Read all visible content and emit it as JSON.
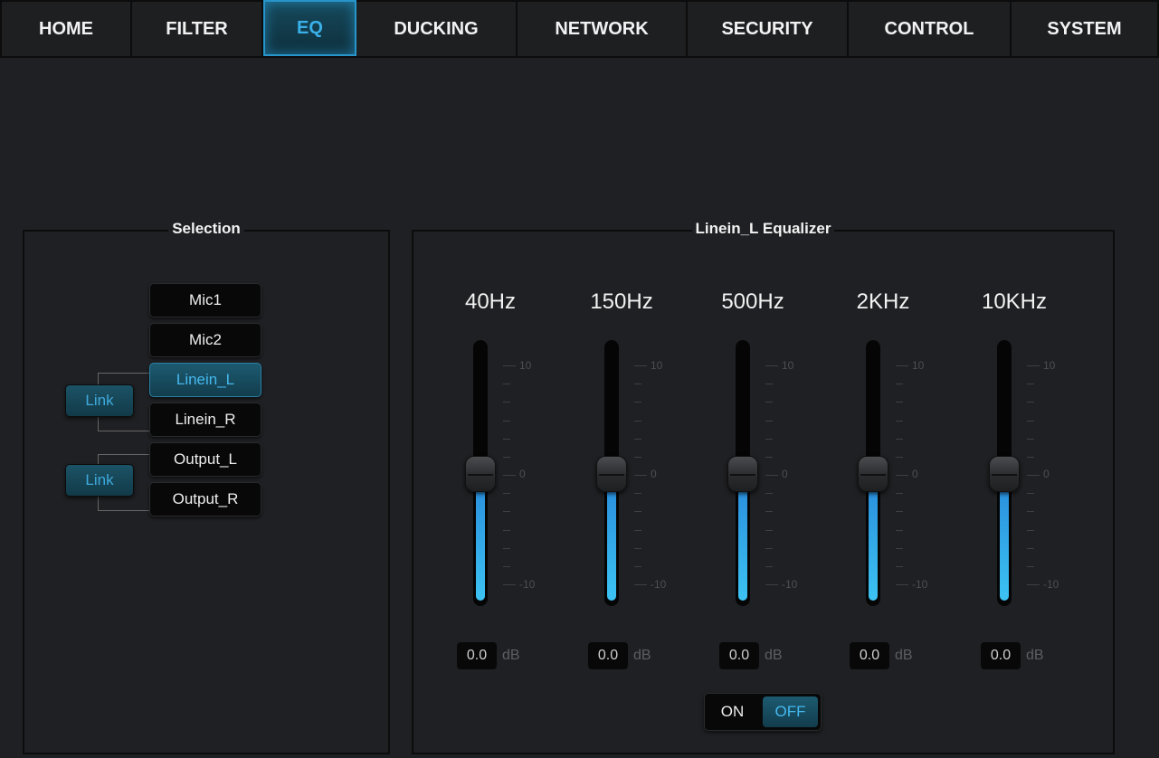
{
  "nav": {
    "tabs": [
      {
        "label": "HOME"
      },
      {
        "label": "FILTER"
      },
      {
        "label": "EQ"
      },
      {
        "label": "DUCKING"
      },
      {
        "label": "NETWORK"
      },
      {
        "label": "SECURITY"
      },
      {
        "label": "CONTROL"
      },
      {
        "label": "SYSTEM"
      }
    ],
    "active": "EQ"
  },
  "selection": {
    "title": "Selection",
    "channels": [
      {
        "label": "Mic1"
      },
      {
        "label": "Mic2"
      },
      {
        "label": "Linein_L"
      },
      {
        "label": "Linein_R"
      },
      {
        "label": "Output_L"
      },
      {
        "label": "Output_R"
      }
    ],
    "active_channel": "Linein_L",
    "link_labels": [
      "Link",
      "Link"
    ]
  },
  "equalizer": {
    "title": "Linein_L Equalizer",
    "scale": {
      "max": "10",
      "mid": "0",
      "min": "-10"
    },
    "unit": "dB",
    "bands": [
      {
        "label": "40Hz",
        "value": "0.0"
      },
      {
        "label": "150Hz",
        "value": "0.0"
      },
      {
        "label": "500Hz",
        "value": "0.0"
      },
      {
        "label": "2KHz",
        "value": "0.0"
      },
      {
        "label": "10KHz",
        "value": "0.0"
      }
    ],
    "toggle": {
      "on_label": "ON",
      "off_label": "OFF",
      "selected": "OFF"
    }
  },
  "colors": {
    "accent": "#3ab0e8",
    "background": "#1f2023",
    "slider_fill": "#3cc3f2"
  }
}
